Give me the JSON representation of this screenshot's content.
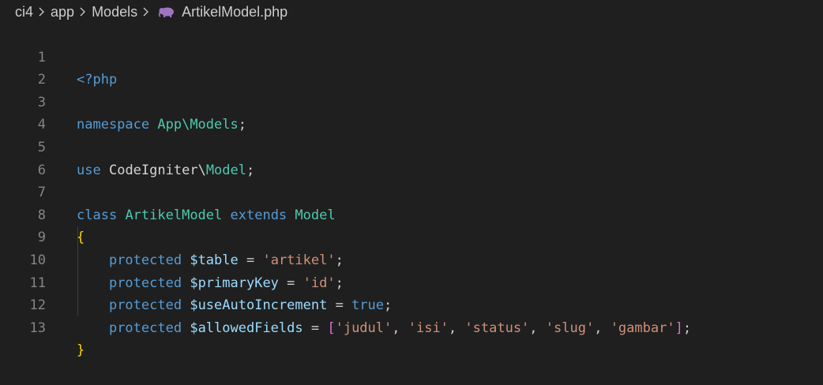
{
  "breadcrumb": {
    "items": [
      "ci4",
      "app",
      "Models",
      "ArtikelModel.php"
    ],
    "file_icon": "php-elephant-icon"
  },
  "editor": {
    "line_numbers": [
      "1",
      "2",
      "3",
      "4",
      "5",
      "6",
      "7",
      "8",
      "9",
      "10",
      "11",
      "12",
      "13"
    ],
    "lines": {
      "l1": {
        "open_tag": "<?php"
      },
      "l3": {
        "kw": "namespace",
        "ns": "App\\Models",
        "semi": ";"
      },
      "l5": {
        "kw": "use",
        "ns1": "CodeIgniter",
        "bs": "\\",
        "ns2": "Model",
        "semi": ";"
      },
      "l7": {
        "kw1": "class",
        "name": "ArtikelModel",
        "kw2": "extends",
        "parent": "Model"
      },
      "l8": {
        "brace": "{"
      },
      "l9": {
        "kw": "protected",
        "var": "$table",
        "eq": " = ",
        "val": "'artikel'",
        "semi": ";"
      },
      "l10": {
        "kw": "protected",
        "var": "$primaryKey",
        "eq": " = ",
        "val": "'id'",
        "semi": ";"
      },
      "l11": {
        "kw": "protected",
        "var": "$useAutoIncrement",
        "eq": " = ",
        "val": "true",
        "semi": ";"
      },
      "l12": {
        "kw": "protected",
        "var": "$allowedFields",
        "eq": " = ",
        "open": "[",
        "items": [
          "'judul'",
          "'isi'",
          "'status'",
          "'slug'",
          "'gambar'"
        ],
        "comma": ", ",
        "close": "]",
        "semi": ";"
      },
      "l13": {
        "brace": "}"
      }
    }
  },
  "colors": {
    "background": "#1f1f1f",
    "keyword": "#569cd6",
    "type": "#4ec9b0",
    "variable": "#9cdcfe",
    "string": "#ce9178",
    "brace": "#ffd700",
    "bracket": "#da70d6",
    "line_number": "#858585"
  }
}
